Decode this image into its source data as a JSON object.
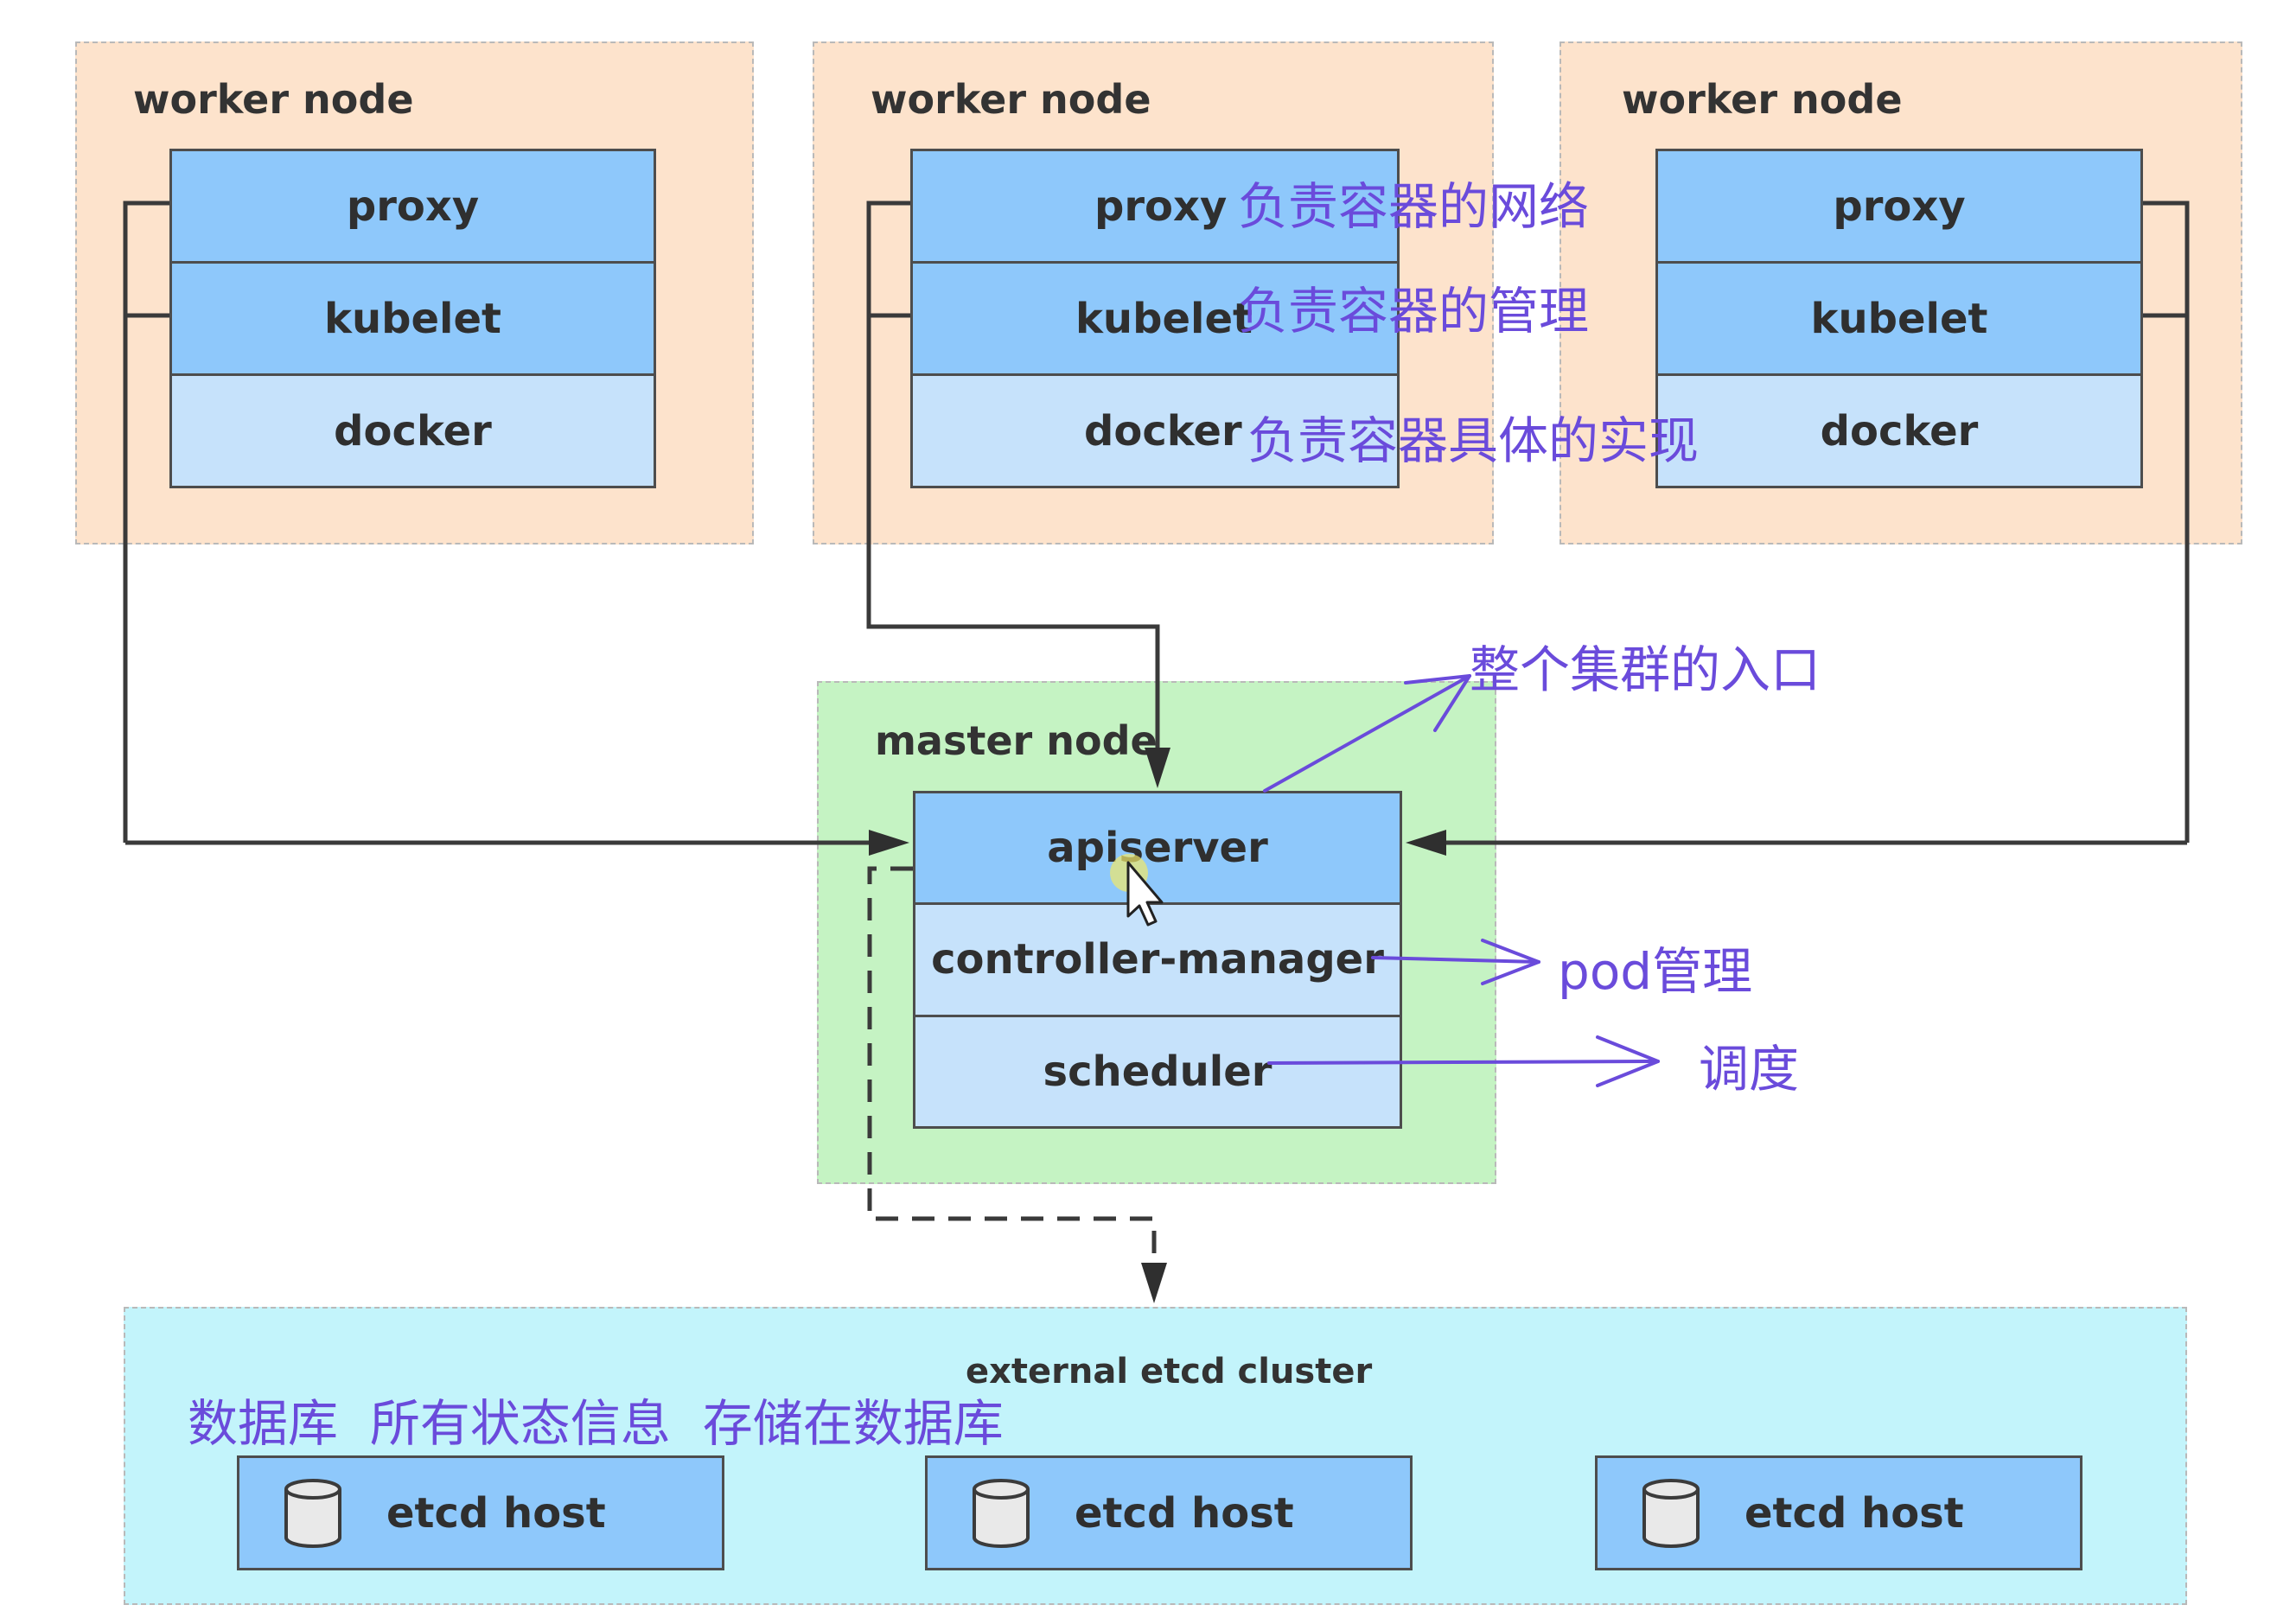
{
  "workers": [
    {
      "title": "worker node",
      "components": [
        "proxy",
        "kubelet",
        "docker"
      ]
    },
    {
      "title": "worker node",
      "components": [
        "proxy",
        "kubelet",
        "docker"
      ]
    },
    {
      "title": "worker node",
      "components": [
        "proxy",
        "kubelet",
        "docker"
      ]
    }
  ],
  "master": {
    "title": "master node",
    "components": [
      "apiserver",
      "controller-manager",
      "scheduler"
    ]
  },
  "etcd": {
    "title": "external etcd cluster",
    "hosts": [
      "etcd host",
      "etcd host",
      "etcd host"
    ]
  },
  "annotations": {
    "proxy": "负责容器的网络",
    "kubelet": "负责容器的管理",
    "docker": "负责容器具体的实现",
    "apiserver": "整个集群的入口",
    "controller_manager": "pod管理",
    "scheduler": "调度",
    "etcd": "数据库  所有状态信息  存储在数据库"
  },
  "colors": {
    "worker_bg": "#fde3cc",
    "master_bg": "#c5f3c3",
    "etcd_bg": "#c3f4fb",
    "component_dark": "#8ec8fb",
    "component_light": "#c6e2fb",
    "annotation": "#6a4bdb"
  },
  "icons": {
    "etcd_host": "database-icon",
    "cursor": "mouse-pointer-icon"
  }
}
